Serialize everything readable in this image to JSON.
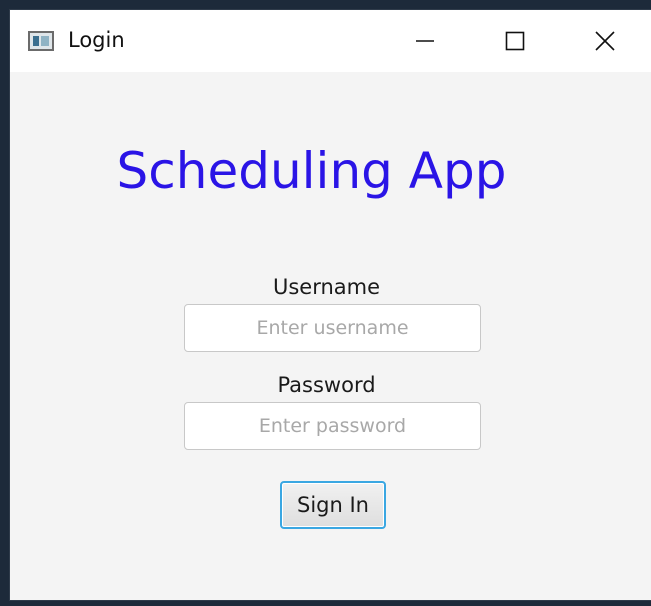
{
  "window": {
    "title": "Login",
    "controls": {
      "minimize": "minimize-icon",
      "maximize": "maximize-icon",
      "close": "close-icon"
    }
  },
  "main": {
    "app_title": "Scheduling App",
    "username": {
      "label": "Username",
      "placeholder": "Enter username",
      "value": ""
    },
    "password": {
      "label": "Password",
      "placeholder": "Enter password",
      "value": ""
    },
    "sign_in_label": "Sign In"
  },
  "colors": {
    "title_accent": "#2a14e6",
    "focus_ring": "#3aa7e2",
    "window_bg": "#f4f4f4",
    "titlebar_bg": "#ffffff"
  }
}
